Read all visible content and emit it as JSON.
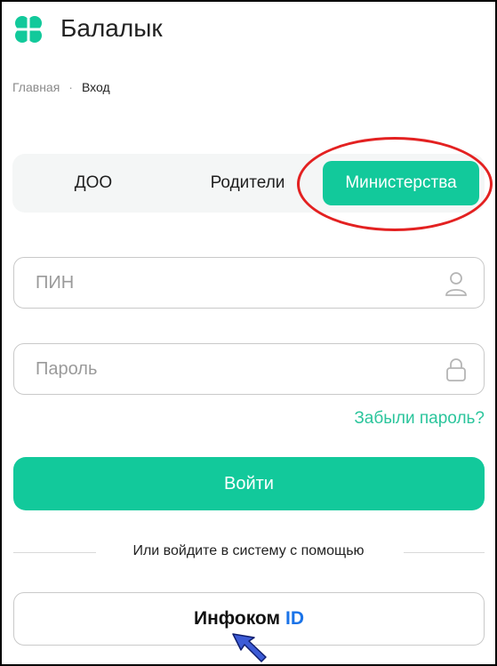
{
  "header": {
    "title": "Балалык",
    "logo_icon": "clover-icon",
    "brand_color": "#12c99b"
  },
  "breadcrumb": {
    "home": "Главная",
    "separator": "·",
    "current": "Вход"
  },
  "tabs": [
    {
      "label": "ДОО",
      "active": false
    },
    {
      "label": "Родители",
      "active": false
    },
    {
      "label": "Министерства",
      "active": true
    }
  ],
  "form": {
    "pin_placeholder": "ПИН",
    "pin_icon": "user-icon",
    "password_placeholder": "Пароль",
    "password_icon": "lock-icon",
    "forgot_password": "Забыли пароль?",
    "login_button": "Войти"
  },
  "divider_text": "Или войдите в систему с помощью",
  "infocom": {
    "label": "Инфоком",
    "id": "ID",
    "id_color": "#1a73e8"
  },
  "annotation": {
    "highlight_color": "#e32121",
    "arrow_icon": "pointer-arrow-icon"
  }
}
